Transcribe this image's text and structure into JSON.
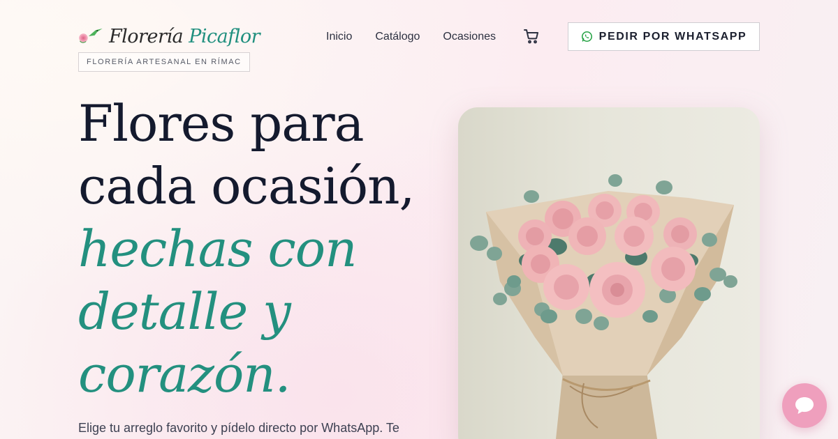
{
  "brand": {
    "name_part1": "Florería",
    "name_part2": "Picaflor",
    "tagline": "FLORERÍA ARTESANAL EN RÍMAC",
    "logo_icon": "hummingbird-rose-icon"
  },
  "nav": {
    "items": [
      {
        "label": "Inicio"
      },
      {
        "label": "Catálogo"
      },
      {
        "label": "Ocasiones"
      }
    ],
    "cart_icon": "cart-icon"
  },
  "cta": {
    "label": "PEDIR POR WHATSAPP",
    "icon": "whatsapp-icon"
  },
  "hero": {
    "line1": "Flores para",
    "line2": "cada ocasión,",
    "accent1": "hechas con",
    "accent2": "detalle y",
    "accent3": "corazón.",
    "subtext": "Elige tu arreglo favorito y pídelo directo por WhatsApp. Te",
    "image": "pink-rose-bouquet-photo"
  },
  "chat": {
    "icon": "chat-bubble-icon"
  },
  "colors": {
    "accent": "#23907f",
    "heading": "#141a2e",
    "chat_button": "#ef9fbd"
  }
}
